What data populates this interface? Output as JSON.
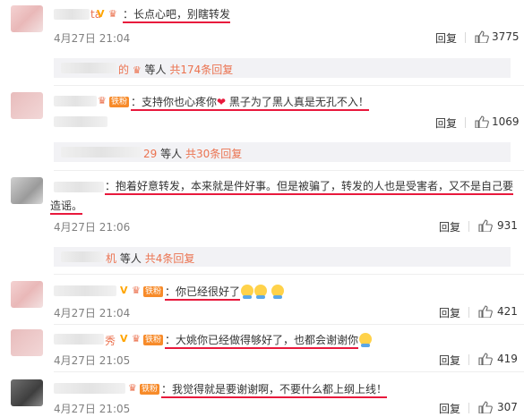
{
  "comments": [
    {
      "name_suffix": "ta",
      "text": "：长点心吧，别瞎转发",
      "time": "4月27日 21:04",
      "reply": "回复",
      "likes": "3775",
      "subreplies": {
        "suffix": "的",
        "text1": "等人",
        "text2": "共174条回复"
      }
    },
    {
      "badge": "铁粉",
      "text_a": "：支持你也心疼你",
      "text_b": "黑子为了黑人真是无孔不入！",
      "reply": "回复",
      "likes": "1069",
      "subreplies": {
        "suffix": "29",
        "text1": "等人",
        "text2": "共30条回复"
      }
    },
    {
      "text_line1": "：抱着好意转发，本来就是件好事。但是被骗了，转发的人也是受害者，又不是自己要",
      "text_line2": "造谣。",
      "time": "4月27日 21:06",
      "reply": "回复",
      "likes": "931",
      "subreplies": {
        "suffix": "机",
        "text1": "等人",
        "text2": "共4条回复"
      }
    },
    {
      "badge": "铁粉",
      "text": "：你已经很好了",
      "time": "4月27日 21:04",
      "reply": "回复",
      "likes": "421"
    },
    {
      "name_suffix": "秀",
      "badge": "铁粉",
      "text": "：大姚你已经做得够好了，也都会谢谢你",
      "time": "4月27日 21:05",
      "reply": "回复",
      "likes": "419"
    },
    {
      "badge": "铁粉",
      "text": "：我觉得就是要谢谢啊，不要什么都上纲上线！",
      "time": "4月27日 21:05",
      "reply": "回复",
      "likes": "307"
    }
  ],
  "icons": {
    "like": "thumbs-up-icon",
    "vip": "crown-icon",
    "fan": "fan-badge-icon",
    "heart": "heart-icon"
  },
  "colors": {
    "username": "#eb7350",
    "highlight": "#e8193c",
    "time": "#808080"
  }
}
